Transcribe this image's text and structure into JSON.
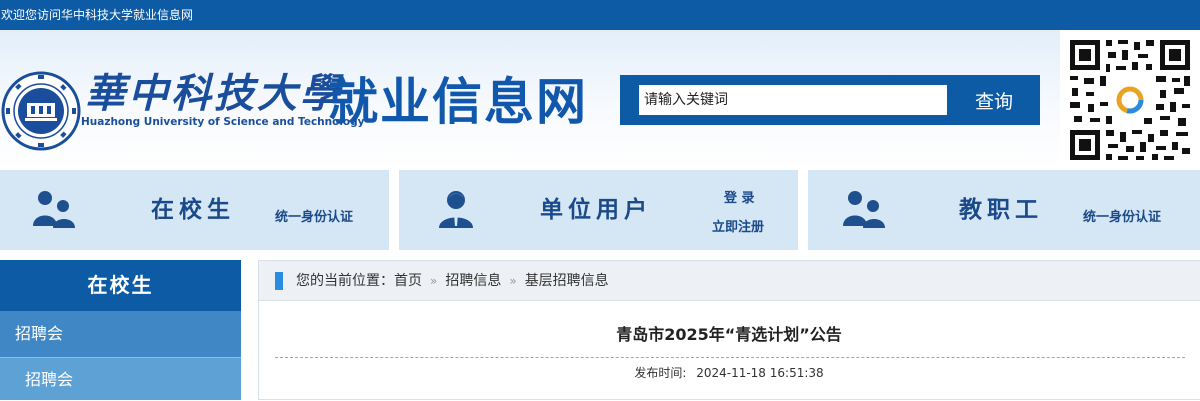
{
  "topbar": {
    "welcome": "欢迎您访问华中科技大学就业信息网"
  },
  "header": {
    "university_cn": "華中科技大學",
    "university_en": "Huazhong University of Science and Technology",
    "site_title": "就业信息网",
    "search": {
      "placeholder": "请输入关键词",
      "button": "查询"
    }
  },
  "nav": {
    "student": {
      "label": "在校生",
      "link": "统一身份认证"
    },
    "employer": {
      "label": "单位用户",
      "login": "登 录",
      "register": "立即注册"
    },
    "staff": {
      "label": "教职工",
      "link": "统一身份认证"
    }
  },
  "sidebar": {
    "title": "在校生",
    "item": "招聘会",
    "subitem": "招聘会"
  },
  "breadcrumb": {
    "prefix": "您的当前位置：",
    "items": [
      "首页",
      "招聘信息",
      "基层招聘信息"
    ]
  },
  "article": {
    "title": "青岛市2025年“青选计划”公告",
    "published_label": "发布时间:",
    "published_value": "2024-11-18 16:51:38"
  },
  "colors": {
    "brand_blue": "#0d5aa5",
    "nav_bg": "#d5e6f4",
    "sidebar_blue": "#3f88c5"
  }
}
